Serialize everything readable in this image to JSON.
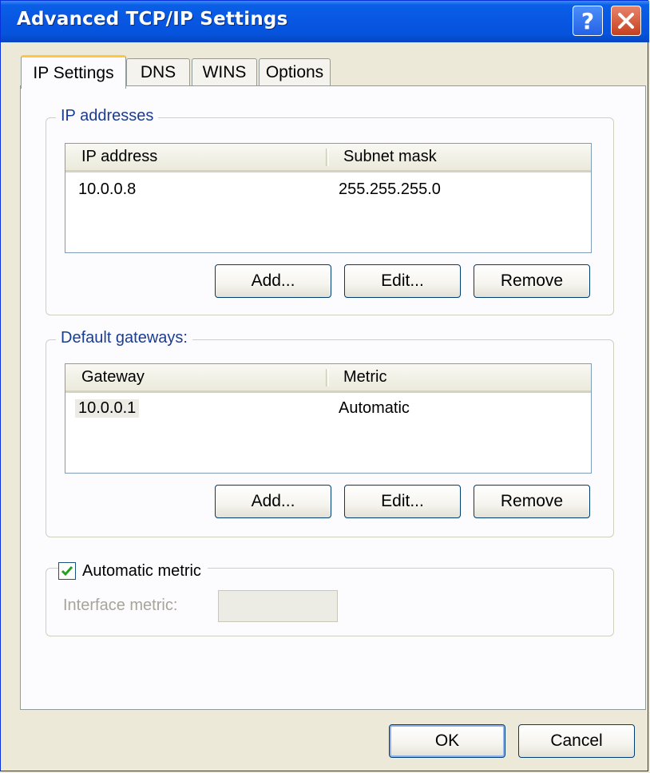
{
  "window": {
    "title": "Advanced TCP/IP Settings"
  },
  "titlebar_buttons": {
    "help": "?",
    "close": "close-icon"
  },
  "tabs": [
    {
      "label": "IP Settings",
      "active": true
    },
    {
      "label": "DNS",
      "active": false
    },
    {
      "label": "WINS",
      "active": false
    },
    {
      "label": "Options",
      "active": false
    }
  ],
  "ip_addresses": {
    "group_label": "IP addresses",
    "columns": [
      "IP address",
      "Subnet mask"
    ],
    "rows": [
      {
        "ip": "10.0.0.8",
        "mask": "255.255.255.0"
      }
    ],
    "buttons": {
      "add": "Add...",
      "edit": "Edit...",
      "remove": "Remove"
    }
  },
  "gateways": {
    "group_label": "Default gateways:",
    "columns": [
      "Gateway",
      "Metric"
    ],
    "rows": [
      {
        "gateway": "10.0.0.1",
        "metric": "Automatic"
      }
    ],
    "buttons": {
      "add": "Add...",
      "edit": "Edit...",
      "remove": "Remove"
    }
  },
  "metric": {
    "checkbox_label": "Automatic metric",
    "checked": true,
    "interface_label": "Interface metric:",
    "interface_value": ""
  },
  "footer": {
    "ok": "OK",
    "cancel": "Cancel"
  },
  "colors": {
    "titlebar": "#0856e2",
    "face": "#ece9d8",
    "group_title": "#1b3d91",
    "check": "#21a121"
  }
}
